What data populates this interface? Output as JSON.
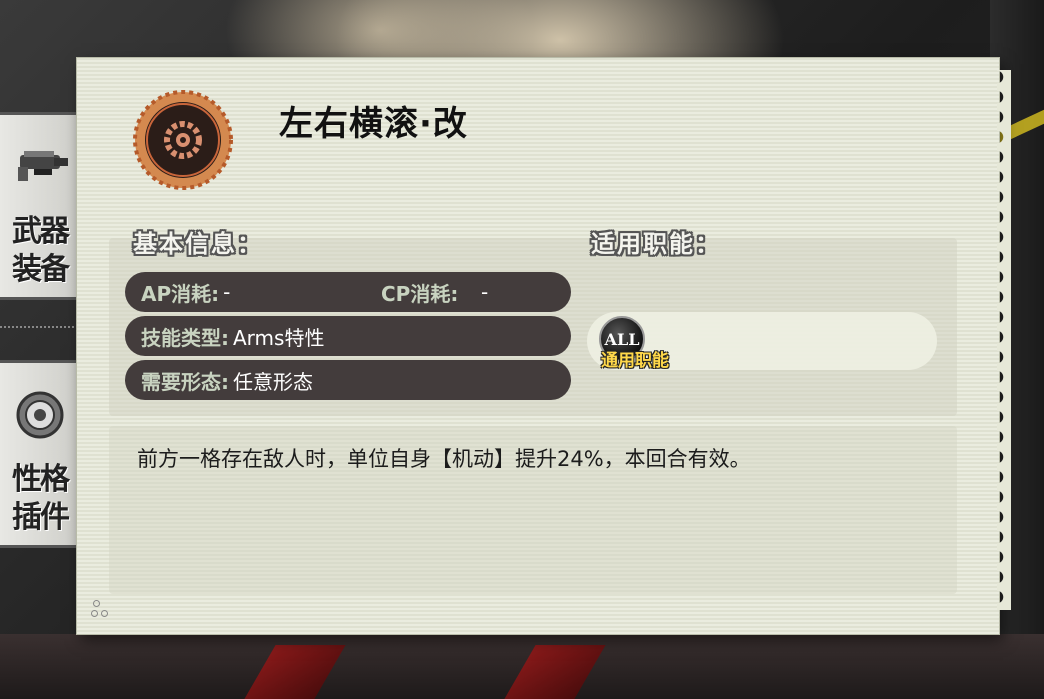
{
  "panel": {
    "title": "左右横滚·改",
    "skill_icon": "gear-emblem-icon",
    "basic_info_heading": "基本信息：",
    "roles_heading": "适用职能：",
    "rows": {
      "ap_label": "AP消耗:",
      "ap_value": "-",
      "cp_label": "CP消耗:",
      "cp_value": "-",
      "skill_type_label": "技能类型:",
      "skill_type_value": "Arms特性",
      "form_label": "需要形态:",
      "form_value": "任意形态"
    },
    "role_badge": {
      "icon_text": "ALL",
      "label": "通用职能"
    },
    "description": "前方一格存在敌人时，单位自身【机动】提升24%，本回合有效。"
  },
  "side_menu": {
    "weapon_label": "武器装备",
    "plugin_label": "性格插件"
  },
  "colors": {
    "panel_bg": "#e6e8d8",
    "row_bg": "#433c3c",
    "row_key": "#c8d3c0",
    "icon_ring": "#c8653a",
    "badge_text": "#ffd84a"
  }
}
